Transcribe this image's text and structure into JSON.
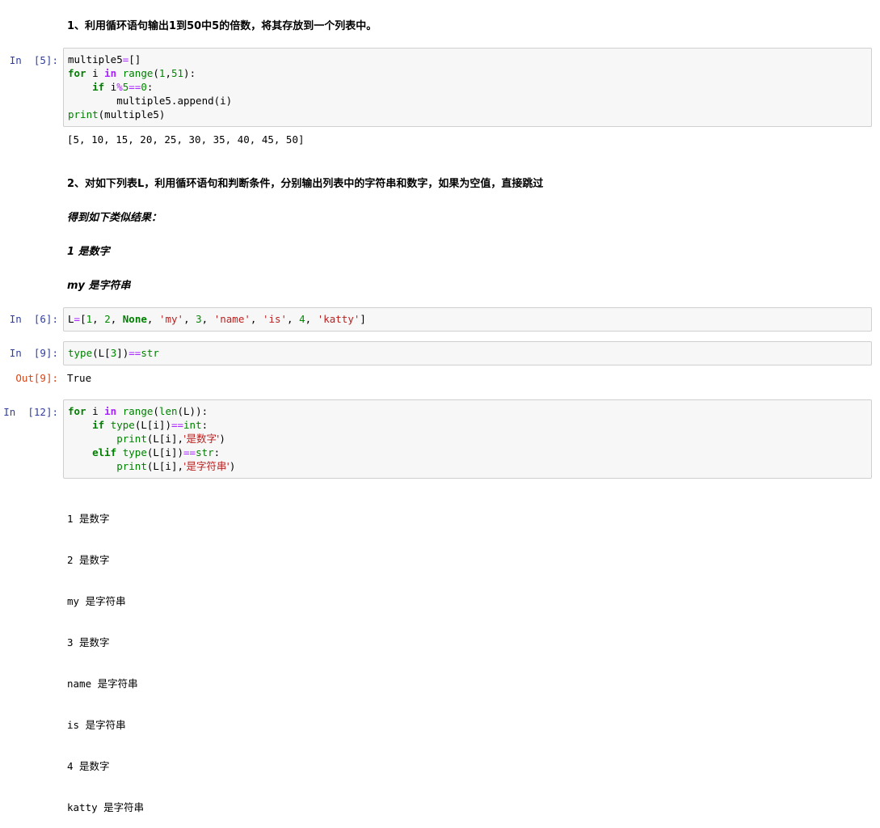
{
  "markdown": {
    "q1": "1、利用循环语句输出1到50中5的倍数，将其存放到一个列表中。",
    "q2": "2、对如下列表L，利用循环语句和判断条件，分别输出列表中的字符串和数字，如果为空值，直接跳过",
    "q2_hint": "得到如下类似结果：",
    "q2_example1": "1 是数字",
    "q2_example2": "my 是字符串"
  },
  "cells": [
    {
      "prompt": "In  [5]:",
      "output": "[5, 10, 15, 20, 25, 30, 35, 40, 45, 50]"
    },
    {
      "prompt": "In  [6]:"
    },
    {
      "prompt": "In  [9]:",
      "out_prompt": "Out[9]:",
      "output": "True"
    },
    {
      "prompt": "In  [12]:",
      "output_lines": [
        "1 是数字",
        "2 是数字",
        "my 是字符串",
        "3 是数字",
        "name 是字符串",
        "is 是字符串",
        "4 是数字",
        "katty 是字符串"
      ]
    }
  ],
  "code": {
    "c5": {
      "l1_var": "multiple5",
      "l1_list": "[]",
      "l2_var": " i ",
      "l2_range": "range",
      "l2_args_open": "(",
      "l2_a": "1",
      "l2_comma": ",",
      "l2_b": "51",
      "l2_args_close": "):",
      "l3_var": " i",
      "l3_zero": "0",
      "l3_colon": ":",
      "l4": "        multiple5.append(i)",
      "l5_print": "print",
      "l5_arg": "(multiple5)"
    },
    "c6": {
      "var": "L",
      "open": "[",
      "n1": "1",
      "n2": "2",
      "none": "None",
      "s1": "'my'",
      "n3": "3",
      "s2": "'name'",
      "s3": "'is'",
      "n4": "4",
      "s4": "'katty'",
      "close": "]",
      "sep": ", "
    },
    "c9": {
      "type": "type",
      "arg_open": "(L[",
      "idx": "3",
      "arg_close": "])",
      "str": "str"
    },
    "c12": {
      "range": "range",
      "len": "len",
      "l1_args": "(L)):",
      "type": "type",
      "cond": "(L[i])",
      "int": "int",
      "print": "print",
      "pargs_open": "(L[i],",
      "s_num": "'是数字'",
      "s_str": "'是字符串'",
      "close": ")",
      "str": "str"
    }
  }
}
